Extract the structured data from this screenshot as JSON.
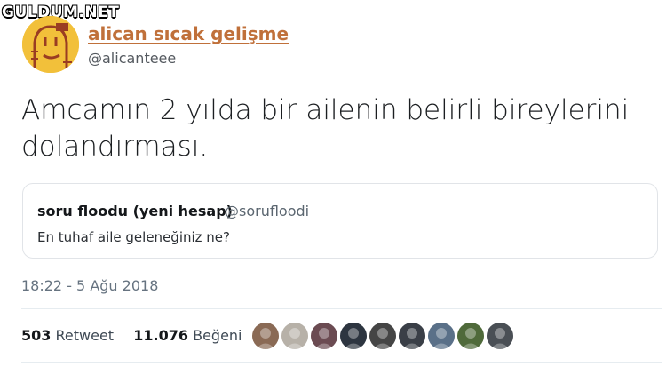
{
  "watermark": "GULDUM.NET",
  "author": {
    "display_name": "alican sıcak gelişme",
    "handle": "@alicanteee",
    "avatar_icon": "hand-drawn-face-avatar"
  },
  "tweet": {
    "text": "Amcamın 2 yılda bir ailenin belirli bireylerini dolandırması."
  },
  "quoted_tweet": {
    "display_name": "soru floodu (yeni hesap)",
    "handle": "@sorufloodi",
    "text": "En tuhaf aile geleneğiniz ne?"
  },
  "timestamp": "18:22 - 5 Ağu 2018",
  "stats": {
    "retweet_count": "503",
    "retweet_label": "Retweet",
    "like_count": "11.076",
    "like_label": "Beğeni"
  },
  "likers": [
    {
      "icon": "user-avatar",
      "color": "#8a6a55"
    },
    {
      "icon": "user-avatar",
      "color": "#b7b1a8"
    },
    {
      "icon": "user-avatar",
      "color": "#6b4b52"
    },
    {
      "icon": "user-avatar",
      "color": "#2d3540"
    },
    {
      "icon": "user-avatar",
      "color": "#454545"
    },
    {
      "icon": "user-avatar",
      "color": "#3a3f47"
    },
    {
      "icon": "user-avatar",
      "color": "#5a7088"
    },
    {
      "icon": "user-avatar",
      "color": "#4f6a3a"
    },
    {
      "icon": "user-avatar",
      "color": "#4a4f55"
    }
  ],
  "colors": {
    "accent_name": "#c0703a",
    "avatar_bg": "#f2c03a",
    "muted_text": "#667380",
    "border": "#e1e4e8"
  }
}
